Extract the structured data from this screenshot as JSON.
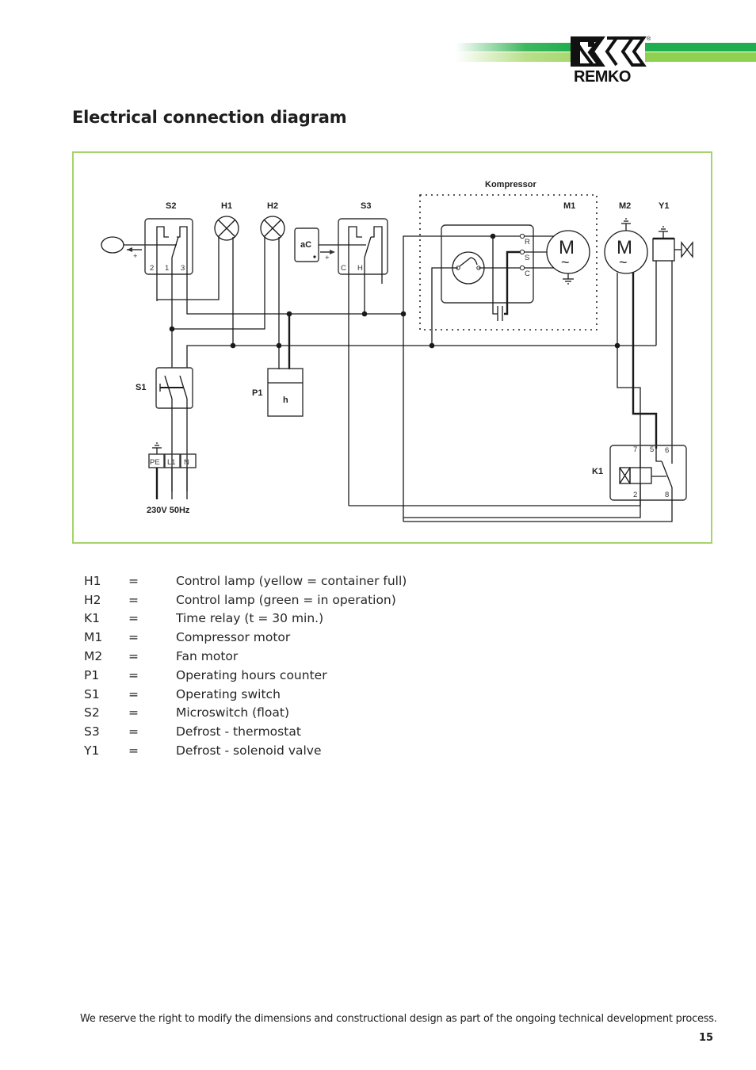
{
  "brand": {
    "name": "REMKO",
    "registered_mark": "®",
    "colors": {
      "dark_green": "#1fae4f",
      "light_green": "#92d050",
      "frame_green": "#a6d36b"
    }
  },
  "page_title": "Electrical connection diagram",
  "diagram": {
    "group_label": "Kompressor",
    "component_labels": {
      "S2": "S2",
      "H1": "H1",
      "H2": "H2",
      "S3": "S3",
      "M1": "M1",
      "M2": "M2",
      "Y1": "Y1",
      "S1": "S1",
      "P1": "P1",
      "K1": "K1",
      "aC": "aC",
      "h": "h"
    },
    "motor_symbol": "M",
    "ac_symbol": "~",
    "plus_sign": "+",
    "s2_pins": [
      "2",
      "1",
      "3"
    ],
    "s3_pins": [
      "C",
      "H"
    ],
    "compressor_pins": [
      "R",
      "S",
      "C"
    ],
    "k1_pins": [
      "7",
      "5",
      "6",
      "2",
      "8"
    ],
    "terminal_block": [
      "PE",
      "L1",
      "N"
    ],
    "supply": "230V 50Hz"
  },
  "legend": [
    {
      "code": "H1",
      "eq": "=",
      "desc": "Control lamp (yellow = container full)"
    },
    {
      "code": "H2",
      "eq": "=",
      "desc": "Control lamp (green = in operation)"
    },
    {
      "code": "K1",
      "eq": "=",
      "desc": "Time relay (t = 30 min.)"
    },
    {
      "code": "M1",
      "eq": "=",
      "desc": "Compressor motor"
    },
    {
      "code": "M2",
      "eq": "=",
      "desc": "Fan motor"
    },
    {
      "code": "P1",
      "eq": "=",
      "desc": "Operating hours counter"
    },
    {
      "code": "S1",
      "eq": "=",
      "desc": "Operating switch"
    },
    {
      "code": "S2",
      "eq": "=",
      "desc": "Microswitch (float)"
    },
    {
      "code": "S3",
      "eq": "=",
      "desc": "Defrost - thermostat"
    },
    {
      "code": "Y1",
      "eq": "=",
      "desc": "Defrost - solenoid valve"
    }
  ],
  "footer": {
    "note": "We reserve the right to modify the dimensions and constructional design as part of the ongoing technical development process.",
    "page_number": "15"
  }
}
